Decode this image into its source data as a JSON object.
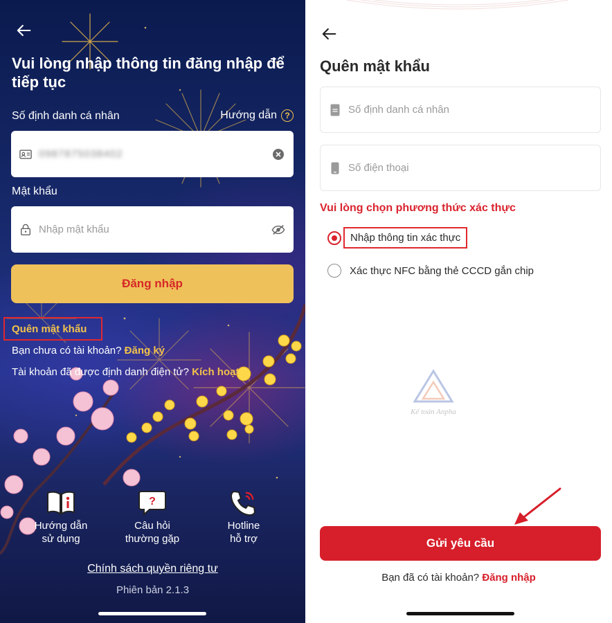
{
  "left": {
    "title": "Vui lòng nhập thông tin đăng nhập để tiếp tục",
    "id_label": "Số định danh cá nhân",
    "guide_label": "Hướng dẫn",
    "id_value": "0987875038402",
    "password_label": "Mật khẩu",
    "password_placeholder": "Nhập mật khẩu",
    "login_button": "Đăng nhập",
    "forgot_password": "Quên mật khẩu",
    "no_account_text": "Bạn chưa có tài khoản?",
    "register_link": "Đăng ký",
    "identified_text": "Tài khoản đã được định danh điện tử?",
    "activate_link": "Kích hoạt",
    "icons": [
      {
        "line1": "Hướng dẫn",
        "line2": "sử dụng",
        "icon": "user-guide-book-icon"
      },
      {
        "line1": "Câu hỏi",
        "line2": "thường gặp",
        "icon": "faq-question-bubble-icon"
      },
      {
        "line1": "Hotline",
        "line2": "hỗ trợ",
        "icon": "hotline-phone-icon"
      }
    ],
    "privacy_link": "Chính sách quyền riêng tư",
    "version": "Phiên bản 2.1.3"
  },
  "right": {
    "title": "Quên mật khẩu",
    "id_placeholder": "Số định danh cá nhân",
    "phone_placeholder": "Số điện thoại",
    "method_title": "Vui lòng chọn phương thức xác thực",
    "methods": [
      {
        "label": "Nhập thông tin xác thực",
        "selected": true
      },
      {
        "label": "Xác thực NFC bằng thẻ CCCD gắn chip",
        "selected": false
      }
    ],
    "submit_button": "Gửi yêu cầu",
    "have_account_text": "Bạn đã có tài khoản?",
    "login_link": "Đăng nhập",
    "watermark_text": "Kế toán Anpha"
  },
  "colors": {
    "accent_red": "#d61f2a",
    "gold": "#efc15a",
    "highlight_box": "#e0282e",
    "night_blue": "#17296b"
  }
}
